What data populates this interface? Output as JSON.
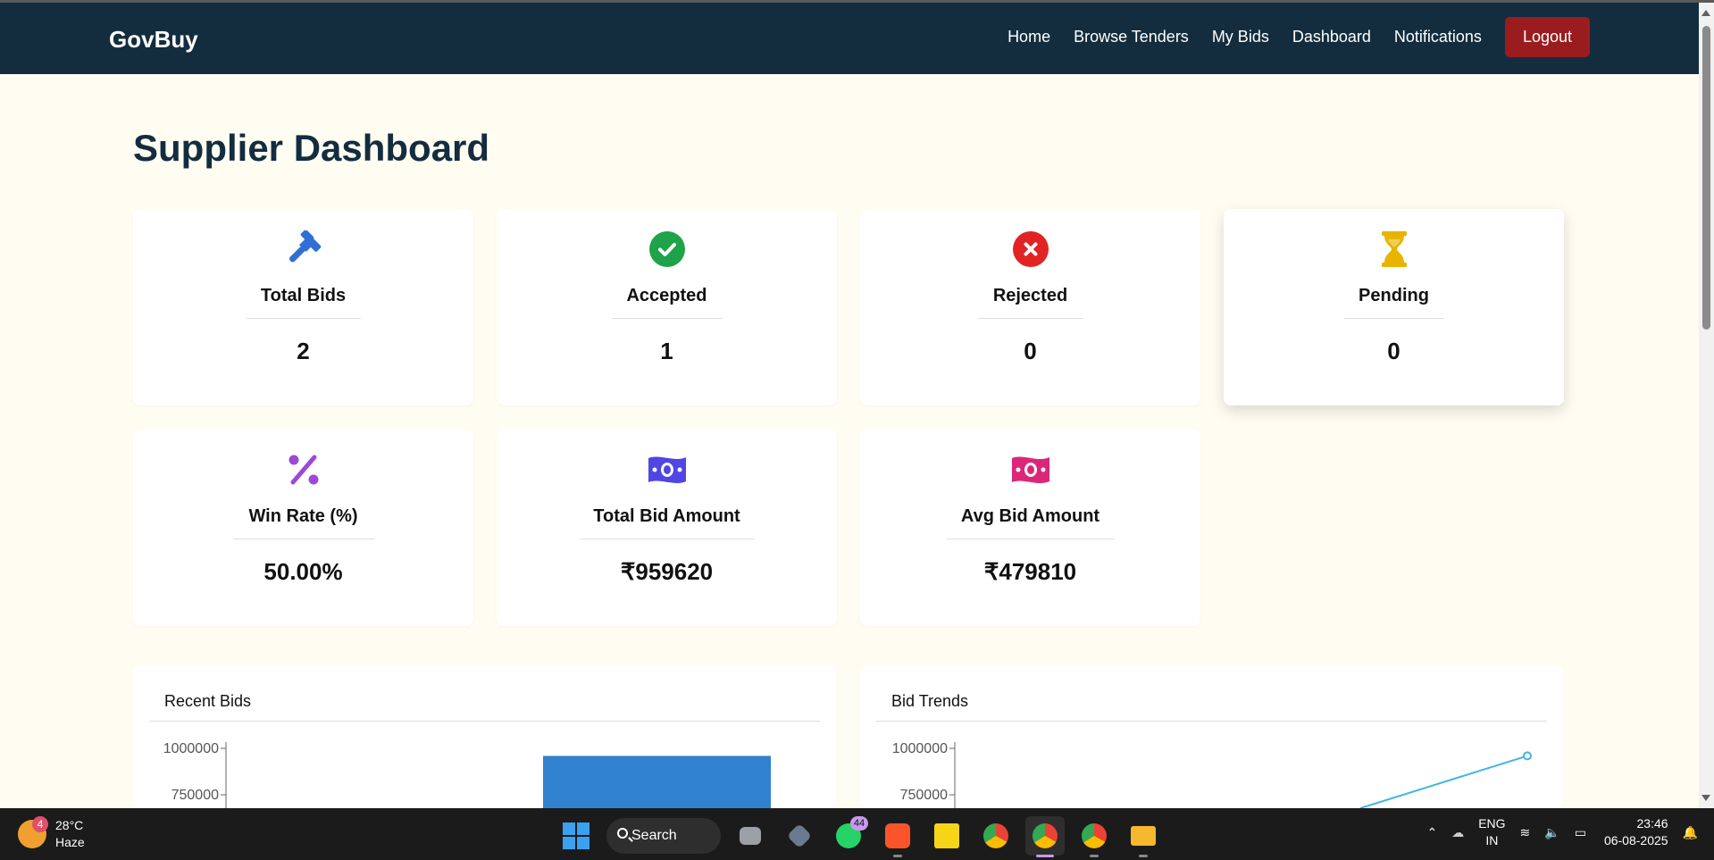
{
  "navbar": {
    "brand": "GovBuy",
    "links": [
      "Home",
      "Browse Tenders",
      "My Bids",
      "Dashboard",
      "Notifications"
    ],
    "logout_label": "Logout",
    "colors": {
      "background": "#132d3e",
      "logout": "#9b1c1f"
    }
  },
  "page": {
    "title": "Supplier Dashboard",
    "background": "#fffdf2"
  },
  "stats": [
    {
      "label": "Total Bids",
      "value": "2",
      "icon": "gavel-icon",
      "color": "#2f6fd6"
    },
    {
      "label": "Accepted",
      "value": "1",
      "icon": "check-circle-icon",
      "color": "#1fa34a"
    },
    {
      "label": "Rejected",
      "value": "0",
      "icon": "x-circle-icon",
      "color": "#e02424"
    },
    {
      "label": "Pending",
      "value": "0",
      "icon": "hourglass-icon",
      "color": "#e8b400"
    },
    {
      "label": "Win Rate (%)",
      "value": "50.00%",
      "icon": "percent-icon",
      "color": "#9b4ad8"
    },
    {
      "label": "Total Bid Amount",
      "value": "₹959620",
      "icon": "money-bill-icon",
      "color": "#4f46e5"
    },
    {
      "label": "Avg Bid Amount",
      "value": "₹479810",
      "icon": "money-bill-icon",
      "color": "#db2777"
    }
  ],
  "charts": {
    "recent_bids": {
      "title": "Recent Bids",
      "bar_color": "#3182ce"
    },
    "bid_trends": {
      "title": "Bid Trends",
      "line_color": "#3fb6e0"
    }
  },
  "chart_data": [
    {
      "type": "bar",
      "title": "Recent Bids",
      "ytick_labels": [
        "1000000",
        "750000"
      ],
      "visible_bar_values": [
        959620
      ],
      "note_axis_max": 1000000
    },
    {
      "type": "line",
      "title": "Bid Trends",
      "ytick_labels": [
        "1000000",
        "750000"
      ],
      "visible_points": [
        959620
      ]
    }
  ],
  "taskbar": {
    "weather": {
      "temp": "28°C",
      "condition": "Haze",
      "badge": "4"
    },
    "search_label": "Search",
    "whatsapp_badge": "44",
    "lang_top": "ENG",
    "lang_bottom": "IN",
    "time": "23:46",
    "date": "06-08-2025"
  }
}
